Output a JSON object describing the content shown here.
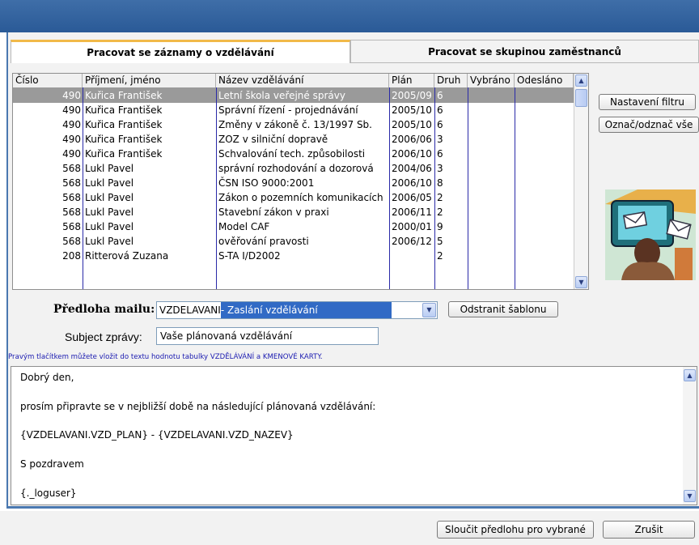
{
  "tabs": [
    {
      "label": "Pracovat se záznamy o vzdělávání",
      "active": true
    },
    {
      "label": "Pracovat se skupinou zaměstnanců",
      "active": false
    }
  ],
  "grid": {
    "columns": [
      "Číslo",
      "Příjmení, jméno",
      "Název vzdělávání",
      "Plán",
      "Druh",
      "Vybráno",
      "Odesláno"
    ],
    "rows": [
      [
        "490",
        "Kuřica František",
        "Letní škola veřejné správy",
        "2005/09",
        "6",
        "",
        ""
      ],
      [
        "490",
        "Kuřica František",
        "Správní řízení - projednávání",
        "2005/10",
        "6",
        "",
        ""
      ],
      [
        "490",
        "Kuřica František",
        "Změny v zákoně č. 13/1997 Sb.",
        "2005/10",
        "6",
        "",
        ""
      ],
      [
        "490",
        "Kuřica František",
        "ZOZ v silniční dopravě",
        "2006/06",
        "3",
        "",
        ""
      ],
      [
        "490",
        "Kuřica František",
        "Schvalování tech. způsobilosti",
        "2006/10",
        "6",
        "",
        ""
      ],
      [
        "568",
        "Lukl Pavel",
        "správní rozhodování a dozorová",
        "2004/06",
        "3",
        "",
        ""
      ],
      [
        "568",
        "Lukl Pavel",
        "ČSN ISO 9000:2001",
        "2006/10",
        "8",
        "",
        ""
      ],
      [
        "568",
        "Lukl Pavel",
        "Zákon o pozemních komunikacích",
        "2006/05",
        "2",
        "",
        ""
      ],
      [
        "568",
        "Lukl Pavel",
        "Stavební zákon v praxi",
        "2006/11",
        "2",
        "",
        ""
      ],
      [
        "568",
        "Lukl Pavel",
        "Model CAF",
        "2000/01",
        "9",
        "",
        ""
      ],
      [
        "568",
        "Lukl Pavel",
        "ověřování pravosti",
        "2006/12",
        "5",
        "",
        ""
      ],
      [
        "208",
        "Ritterová Zuzana",
        "S-TA I/D2002",
        "",
        "2",
        "",
        ""
      ]
    ],
    "selected_row": 0
  },
  "side_buttons": {
    "filter": "Nastavení filtru",
    "toggle_all": "Označ/odznač vše"
  },
  "template": {
    "label": "Předloha mailu:",
    "code": "VZDELAVANI",
    "name": " - Zaslání vzdělávání",
    "remove_button": "Odstranit šablonu"
  },
  "subject": {
    "label": "Subject zprávy:",
    "value": "Vaše plánovaná vzdělávání"
  },
  "hint": "Pravým tlačítkem můžete vložit do textu hodnotu tabulky VZDĚLÁVÁNÍ a KMENOVÉ KARTY.",
  "body_lines": [
    "Dobrý den,",
    "prosím připravte se v nejbližší době na následující plánovaná vzdělávání:",
    "{VZDELAVANI.VZD_PLAN}  -  {VZDELAVANI.VZD_NAZEV}",
    "S pozdravem",
    "{._loguser}"
  ],
  "footer": {
    "merge_button": "Sloučit předlohu pro vybrané",
    "cancel_button": "Zrušit"
  },
  "colors": {
    "titlebar": "#2f5f9c",
    "tab_accent": "#f1b949",
    "selection": "#9a9a9a",
    "column_divider": "#2a2aa8",
    "hint_text": "#1a1ab0"
  }
}
